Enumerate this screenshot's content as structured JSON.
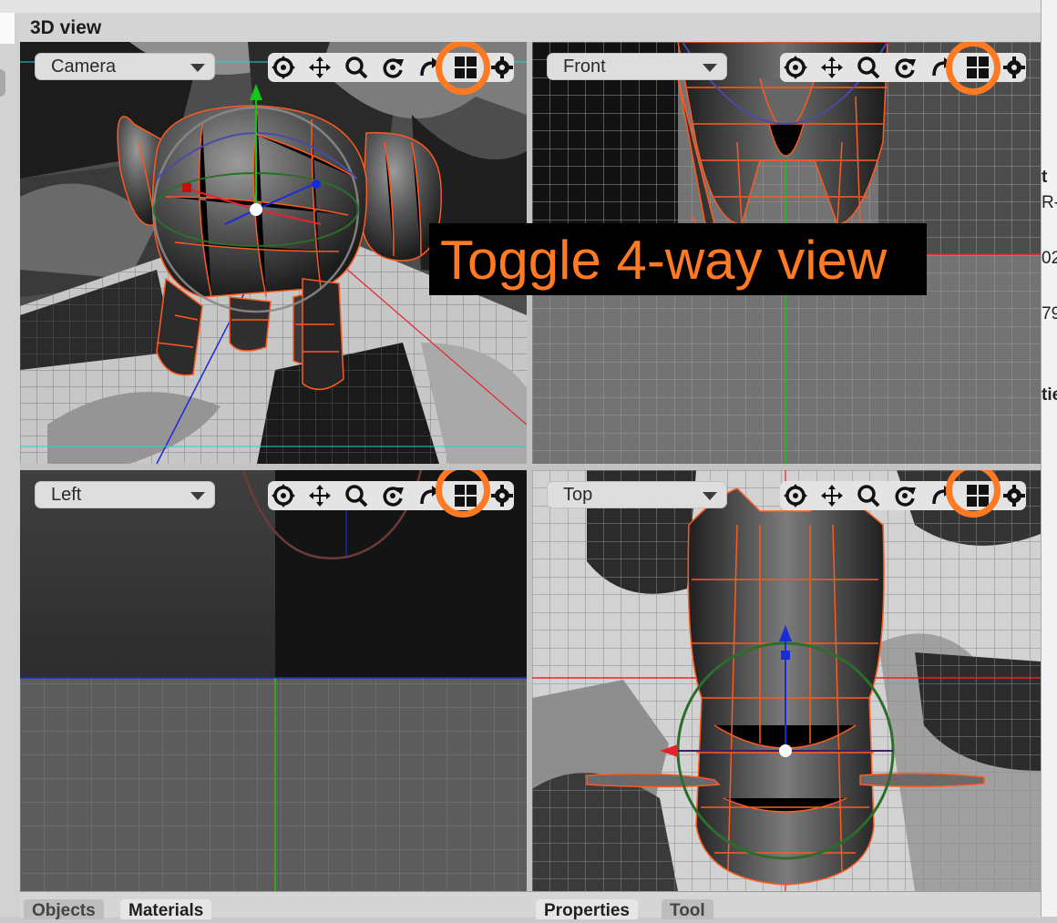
{
  "panel": {
    "title": "3D view"
  },
  "viewports": [
    {
      "name": "Camera"
    },
    {
      "name": "Front"
    },
    {
      "name": "Left"
    },
    {
      "name": "Top"
    }
  ],
  "toolbar_icons": [
    "orbit-icon",
    "pan-icon",
    "zoom-icon",
    "rotate-icon",
    "undo-view-icon",
    "four-way-view-icon",
    "settings-icon"
  ],
  "callout": {
    "text": "Toggle 4-way view"
  },
  "bottom_tabs": {
    "left": [
      "Objects",
      "Materials"
    ],
    "right": [
      "Properties",
      "Tool"
    ]
  },
  "side_panel_fragments": [
    "t",
    "R-",
    "02",
    "79",
    "tie"
  ],
  "colors": {
    "highlight_ring": "#ff7a22",
    "active_border": "#e4242d",
    "wireframe": "#ff5a1f",
    "axis_x": "#e4242d",
    "axis_y": "#16c416",
    "axis_z": "#1a2bd8"
  }
}
